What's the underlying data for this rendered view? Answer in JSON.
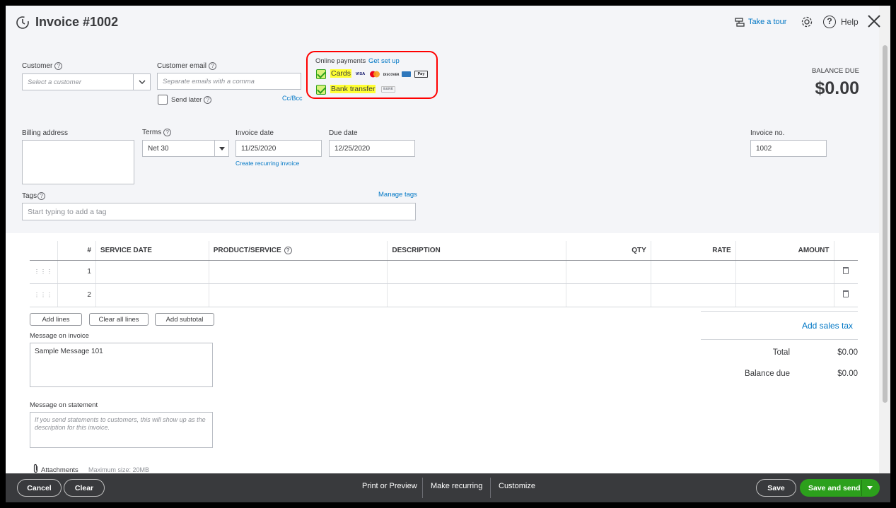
{
  "header": {
    "title": "Invoice #1002",
    "take_tour": "Take a tour",
    "help": "Help"
  },
  "customer": {
    "label": "Customer",
    "placeholder": "Select a customer"
  },
  "email": {
    "label": "Customer email",
    "placeholder": "Separate emails with a comma",
    "send_later": "Send later",
    "cc_bcc": "Cc/Bcc"
  },
  "online_payments": {
    "label": "Online payments",
    "get_set_up": "Get set up",
    "cards_label": "Cards",
    "cards_checked": true,
    "bank_label": "Bank transfer",
    "bank_checked": true,
    "bank_badge": "BANK",
    "card_brands": [
      "VISA",
      "Mastercard",
      "DISCOVER",
      "AMEX",
      "Apple Pay"
    ],
    "highlight_color": "#ff0000"
  },
  "balance": {
    "label": "BALANCE DUE",
    "amount": "$0.00"
  },
  "billing": {
    "label": "Billing address"
  },
  "terms": {
    "label": "Terms",
    "value": "Net 30"
  },
  "invoice_date": {
    "label": "Invoice date",
    "value": "11/25/2020",
    "recurring_link": "Create recurring invoice"
  },
  "due_date": {
    "label": "Due date",
    "value": "12/25/2020"
  },
  "invoice_no": {
    "label": "Invoice no.",
    "value": "1002"
  },
  "tags": {
    "label": "Tags",
    "manage": "Manage tags",
    "placeholder": "Start typing to add a tag"
  },
  "table": {
    "columns": [
      "#",
      "SERVICE DATE",
      "PRODUCT/SERVICE",
      "DESCRIPTION",
      "QTY",
      "RATE",
      "AMOUNT"
    ],
    "rows": [
      {
        "num": "1"
      },
      {
        "num": "2"
      }
    ]
  },
  "actions": {
    "add_lines": "Add lines",
    "clear_all": "Clear all lines",
    "add_subtotal": "Add subtotal"
  },
  "message_invoice": {
    "label": "Message on invoice",
    "value": "Sample Message 101"
  },
  "message_statement": {
    "label": "Message on statement",
    "placeholder": "If you send statements to customers, this will show up as the description for this invoice."
  },
  "attachments": {
    "label": "Attachments",
    "max": "Maximum size: 20MB"
  },
  "totals": {
    "add_sales_tax": "Add sales tax",
    "total_label": "Total",
    "total_value": "$0.00",
    "balance_due_label": "Balance due",
    "balance_due_value": "$0.00"
  },
  "footer": {
    "cancel": "Cancel",
    "clear": "Clear",
    "print_preview": "Print or Preview",
    "make_recurring": "Make recurring",
    "customize": "Customize",
    "save": "Save",
    "save_and_send": "Save and send",
    "accent_color": "#2ca01c"
  }
}
